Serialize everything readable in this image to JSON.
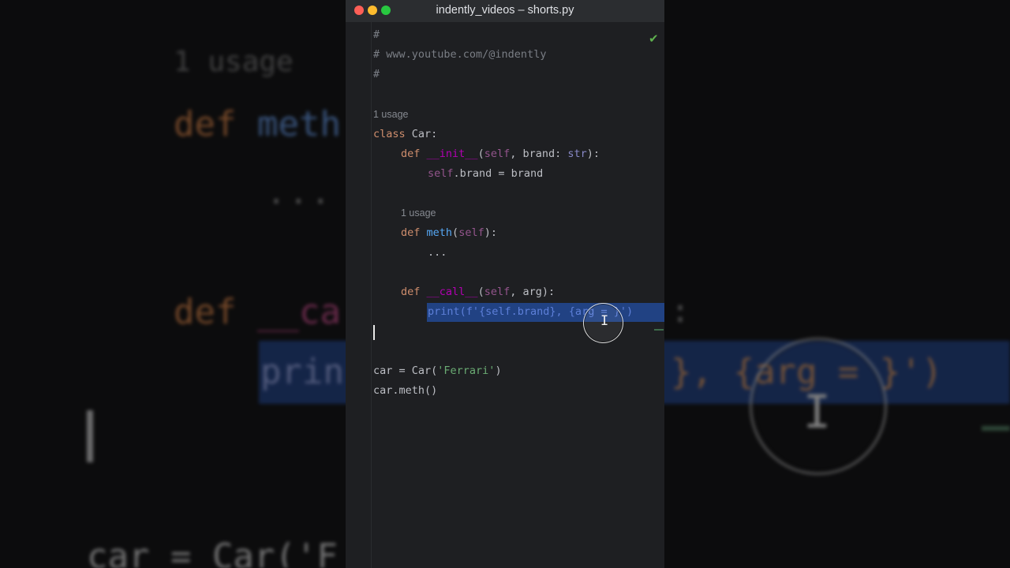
{
  "window": {
    "title": "indently_videos – shorts.py"
  },
  "editor": {
    "lines": {
      "l1": "#",
      "l2": "# www.youtube.com/@indently",
      "l3": "#",
      "usage1": "1 usage",
      "class_kw": "class",
      "class_name": " Car:",
      "def": "def",
      "init_name": "__init__",
      "init_open": "(",
      "self": "self",
      "init_params": ", brand: ",
      "str": "str",
      "init_close": "):",
      "assign_self": "self",
      "assign_rest": ".brand = brand",
      "usage2": "1 usage",
      "meth_name": "meth",
      "meth_open": "(",
      "meth_close": "):",
      "ellipsis": "...",
      "call_name": "__call__",
      "call_open": "(",
      "call_params": ", arg):",
      "print_line": "print(f'{self.brand}, {arg = }')",
      "car_assign": "car = Car(",
      "car_str": "'Ferrari'",
      "car_close": ")",
      "car_meth": "car.meth()"
    }
  },
  "background": {
    "usage": "1 usage",
    "def": "def",
    "meth": " meth",
    "dots": "...",
    "call": " __ca",
    "print": "prin",
    "tail": "}, {arg = }')",
    "car": "car = Car('F",
    "colon": ":"
  },
  "icons": {
    "status": "checkmark-icon",
    "cursor": "text-cursor-icon"
  },
  "colors": {
    "selection": "#214283",
    "keyword": "#cf8e6d",
    "function": "#56a8f5",
    "string": "#6aab73",
    "check": "#5fb14f"
  }
}
